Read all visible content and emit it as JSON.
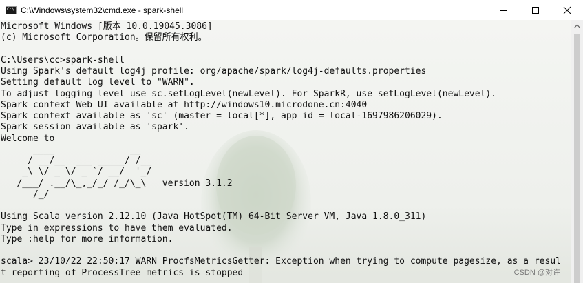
{
  "window": {
    "title": "C:\\Windows\\system32\\cmd.exe - spark-shell",
    "icon": "cmd-icon",
    "controls": [
      "minimize-icon",
      "maximize-icon",
      "close-icon"
    ]
  },
  "console": {
    "lines": [
      "Microsoft Windows [版本 10.0.19045.3086]",
      "(c) Microsoft Corporation。保留所有权利。",
      "",
      "C:\\Users\\cc>spark-shell",
      "Using Spark's default log4j profile: org/apache/spark/log4j-defaults.properties",
      "Setting default log level to \"WARN\".",
      "To adjust logging level use sc.setLogLevel(newLevel). For SparkR, use setLogLevel(newLevel).",
      "Spark context Web UI available at http://windows10.microdone.cn:4040",
      "Spark context available as 'sc' (master = local[*], app id = local-1697986206029).",
      "Spark session available as 'spark'.",
      "Welcome to",
      "      ____              __",
      "     / __/__  ___ _____/ /__",
      "    _\\ \\/ _ \\/ _ `/ __/  '_/",
      "   /___/ .__/\\_,_/_/ /_/\\_\\   version 3.1.2",
      "      /_/",
      "",
      "Using Scala version 2.12.10 (Java HotSpot(TM) 64-Bit Server VM, Java 1.8.0_311)",
      "Type in expressions to have them evaluated.",
      "Type :help for more information.",
      "",
      "scala> 23/10/22 22:50:17 WARN ProcfsMetricsGetter: Exception when trying to compute pagesize, as a resul",
      "t reporting of ProcessTree metrics is stopped"
    ]
  },
  "watermark": "CSDN @对许",
  "colors": {
    "text": "#111111",
    "titlebar": "#ffffff",
    "scrollbar_track": "#f0f0f0",
    "scrollbar_thumb": "#cdcdcd"
  }
}
